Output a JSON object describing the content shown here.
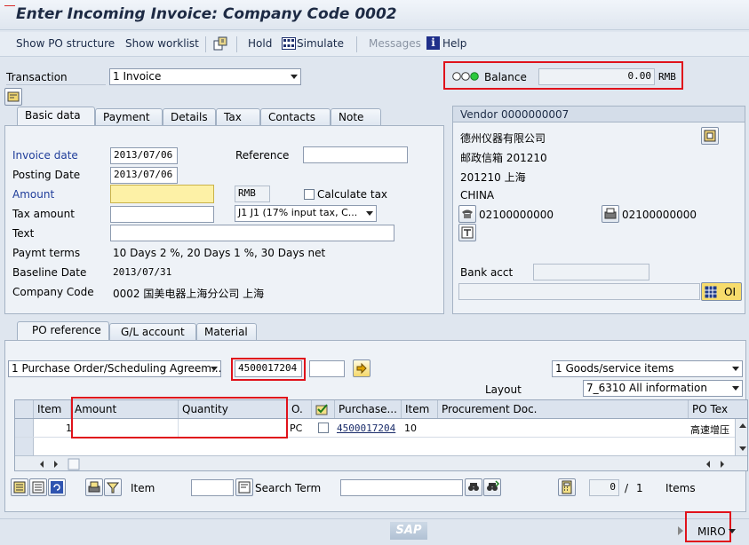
{
  "title": "Enter Incoming Invoice: Company Code 0002",
  "toolbar": {
    "show_po_structure": "Show PO structure",
    "show_worklist": "Show worklist",
    "hold": "Hold",
    "simulate": "Simulate",
    "messages": "Messages",
    "help": "Help"
  },
  "transaction": {
    "label": "Transaction",
    "value": "1 Invoice"
  },
  "balance": {
    "label": "Balance",
    "value": "0.00",
    "currency": "RMB"
  },
  "header_tabs": [
    "Basic data",
    "Payment",
    "Details",
    "Tax",
    "Contacts",
    "Note"
  ],
  "basic_data": {
    "invoice_date_label": "Invoice date",
    "invoice_date": "2013/07/06",
    "reference_label": "Reference",
    "reference": "",
    "posting_date_label": "Posting Date",
    "posting_date": "2013/07/06",
    "amount_label": "Amount",
    "amount": "",
    "currency": "RMB",
    "calculate_tax_label": "Calculate tax",
    "tax_amount_label": "Tax amount",
    "tax_amount": "",
    "tax_code": "J1 J1 (17% input tax, C...",
    "text_label": "Text",
    "text": "",
    "payment_terms_label": "Paymt terms",
    "payment_terms": "10 Days 2 %, 20 Days 1 %, 30 Days net",
    "baseline_date_label": "Baseline Date",
    "baseline_date": "2013/07/31",
    "company_code_label": "Company Code",
    "company_code": "0002 国美电器上海分公司 上海"
  },
  "vendor": {
    "header": "Vendor 0000000007",
    "name": "德州仪器有限公司",
    "po_box": "邮政信箱 201210",
    "city": "201210 上海",
    "country": "CHINA",
    "phone": "02100000000",
    "fax": "02100000000",
    "bank_acct_label": "Bank acct",
    "oi_label": "OI"
  },
  "po_tabs": [
    "PO reference",
    "G/L account",
    "Material"
  ],
  "po_reference": {
    "reference_type": "1 Purchase Order/Scheduling Agreem...",
    "po_number": "4500017204",
    "item_selection": "1 Goods/service items",
    "layout_label": "Layout",
    "layout": "7_6310 All information"
  },
  "grid": {
    "columns": [
      "Item",
      "Amount",
      "Quantity",
      "O.",
      "",
      "Purchase...",
      "Item",
      "Procurement Doc.",
      "PO Tex"
    ],
    "rows": [
      {
        "item": "1",
        "amount": "",
        "quantity": "",
        "o": "PC",
        "purchase": "4500017204",
        "po_item": "10",
        "proc_doc": "",
        "po_text": "高速增压"
      }
    ]
  },
  "bottom_bar": {
    "item_label": "Item",
    "search_term_label": "Search Term",
    "page_current": "0",
    "page_separator": "/",
    "page_total": "1",
    "items_label": "Items"
  },
  "status": {
    "tcode": "MIRO",
    "sap_logo": "SAP"
  },
  "colors": {
    "highlight_red": "#e0121b",
    "required_yellow": "#fdf1a6"
  }
}
